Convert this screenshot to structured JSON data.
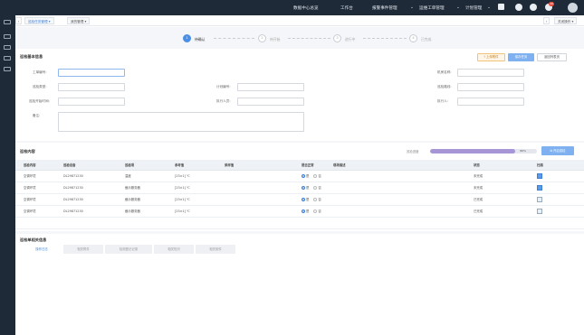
{
  "topnav": {
    "items": [
      "数据中心总览",
      "工作台",
      "报警事件管理",
      "运维工单管理",
      "计划管理"
    ],
    "badge_count": "10"
  },
  "tabs": {
    "items": [
      "巡检任务管理",
      "我的管理"
    ],
    "right_label": "关闭操作"
  },
  "steps": [
    {
      "num": "1",
      "label": "待确认",
      "active": true
    },
    {
      "num": "2",
      "label": "待开始",
      "active": false
    },
    {
      "num": "3",
      "label": "进行中",
      "active": false
    },
    {
      "num": "4",
      "label": "已完成",
      "active": false
    }
  ],
  "basic_info": {
    "title": "巡检基本信息",
    "fields": {
      "work_order": "工单编号:",
      "plan_type": "巡检类型:",
      "room": "机房名称:",
      "plan_name": "计划编号:",
      "route_name": "巡检路线:",
      "start_time": "巡检开始时间:",
      "executor": "执行人员:",
      "approver": "执行人:",
      "remark": "备注:"
    },
    "buttons": {
      "upload": "上传附件",
      "save": "保存任务",
      "back": "返回列表页"
    }
  },
  "inspection": {
    "title": "巡检内容",
    "progress_label": "巡检进度",
    "progress_value": "80%",
    "progress_fraction": 0.8,
    "button": "开启巡检",
    "columns": [
      "巡检内容",
      "巡检设备",
      "巡检项",
      "参考值",
      "采样值",
      "是否正常",
      "现场描述",
      "状态",
      "扫描"
    ],
    "rows": [
      {
        "content": "空调环境",
        "device": "DL29871230",
        "item": "温度",
        "ref": "[23±1] ℃",
        "value": "",
        "ok": true,
        "desc": "",
        "status": "未完成",
        "icon": "blue"
      },
      {
        "content": "空调环境",
        "device": "DL29871230",
        "item": "截示服务器",
        "ref": "[23±1] ℃",
        "value": "",
        "ok": true,
        "desc": "",
        "status": "未完成",
        "icon": "blue"
      },
      {
        "content": "空调环境",
        "device": "DL29871230",
        "item": "截示服务器",
        "ref": "[23±1] ℃",
        "value": "",
        "ok": true,
        "desc": "",
        "status": "已完成",
        "icon": "grey"
      },
      {
        "content": "空调环境",
        "device": "DL29871230",
        "item": "截示服务器",
        "ref": "[23±1] ℃",
        "value": "",
        "ok": true,
        "desc": "",
        "status": "已完成",
        "icon": "grey"
      }
    ],
    "yes_label": "是",
    "no_label": "否"
  },
  "related": {
    "title": "巡检单相关信息",
    "tabs": [
      "操作日志",
      "相关附件",
      "检测登记记录",
      "相关知识",
      "相关软件"
    ]
  }
}
